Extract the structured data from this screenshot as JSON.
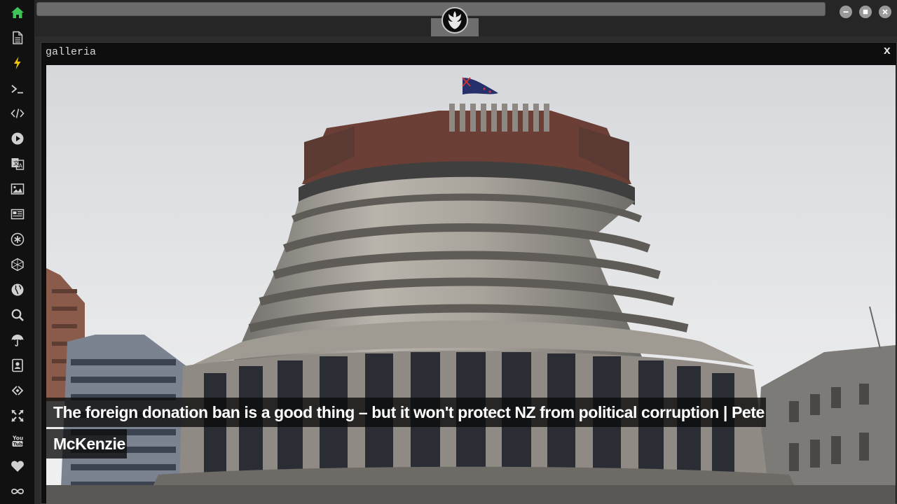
{
  "sidebar": {
    "items": [
      {
        "name": "home-icon",
        "color": "#3fc45a"
      },
      {
        "name": "document-icon",
        "color": "#d0d0d0"
      },
      {
        "name": "lightning-icon",
        "color": "#f1c40f"
      },
      {
        "name": "terminal-icon",
        "color": "#d0d0d0"
      },
      {
        "name": "code-icon",
        "color": "#d0d0d0"
      },
      {
        "name": "play-icon",
        "color": "#d0d0d0"
      },
      {
        "name": "translate-icon",
        "color": "#d0d0d0"
      },
      {
        "name": "image-icon",
        "color": "#d0d0d0"
      },
      {
        "name": "newspaper-icon",
        "color": "#d0d0d0"
      },
      {
        "name": "asterisk-icon",
        "color": "#d0d0d0"
      },
      {
        "name": "hexagon-icon",
        "color": "#d0d0d0"
      },
      {
        "name": "globe-icon",
        "color": "#d0d0d0"
      },
      {
        "name": "search-icon",
        "color": "#d0d0d0"
      },
      {
        "name": "umbrella-icon",
        "color": "#d0d0d0"
      },
      {
        "name": "contact-card-icon",
        "color": "#d0d0d0"
      },
      {
        "name": "link-icon",
        "color": "#d0d0d0"
      },
      {
        "name": "expand-icon",
        "color": "#d0d0d0"
      },
      {
        "name": "youtube-icon",
        "color": "#d0d0d0"
      },
      {
        "name": "heart-icon",
        "color": "#d0d0d0"
      },
      {
        "name": "infinity-icon",
        "color": "#d0d0d0"
      }
    ]
  },
  "panel": {
    "title": "galleria",
    "close_label": "x"
  },
  "gallery": {
    "caption": "The foreign donation ban is a good thing – but it won't protect NZ from political corruption | Pete McKenzie"
  },
  "colors": {
    "accent": "#3fc45a",
    "sidebar_bg": "#111111",
    "panel_bg": "#0e0e0e"
  }
}
